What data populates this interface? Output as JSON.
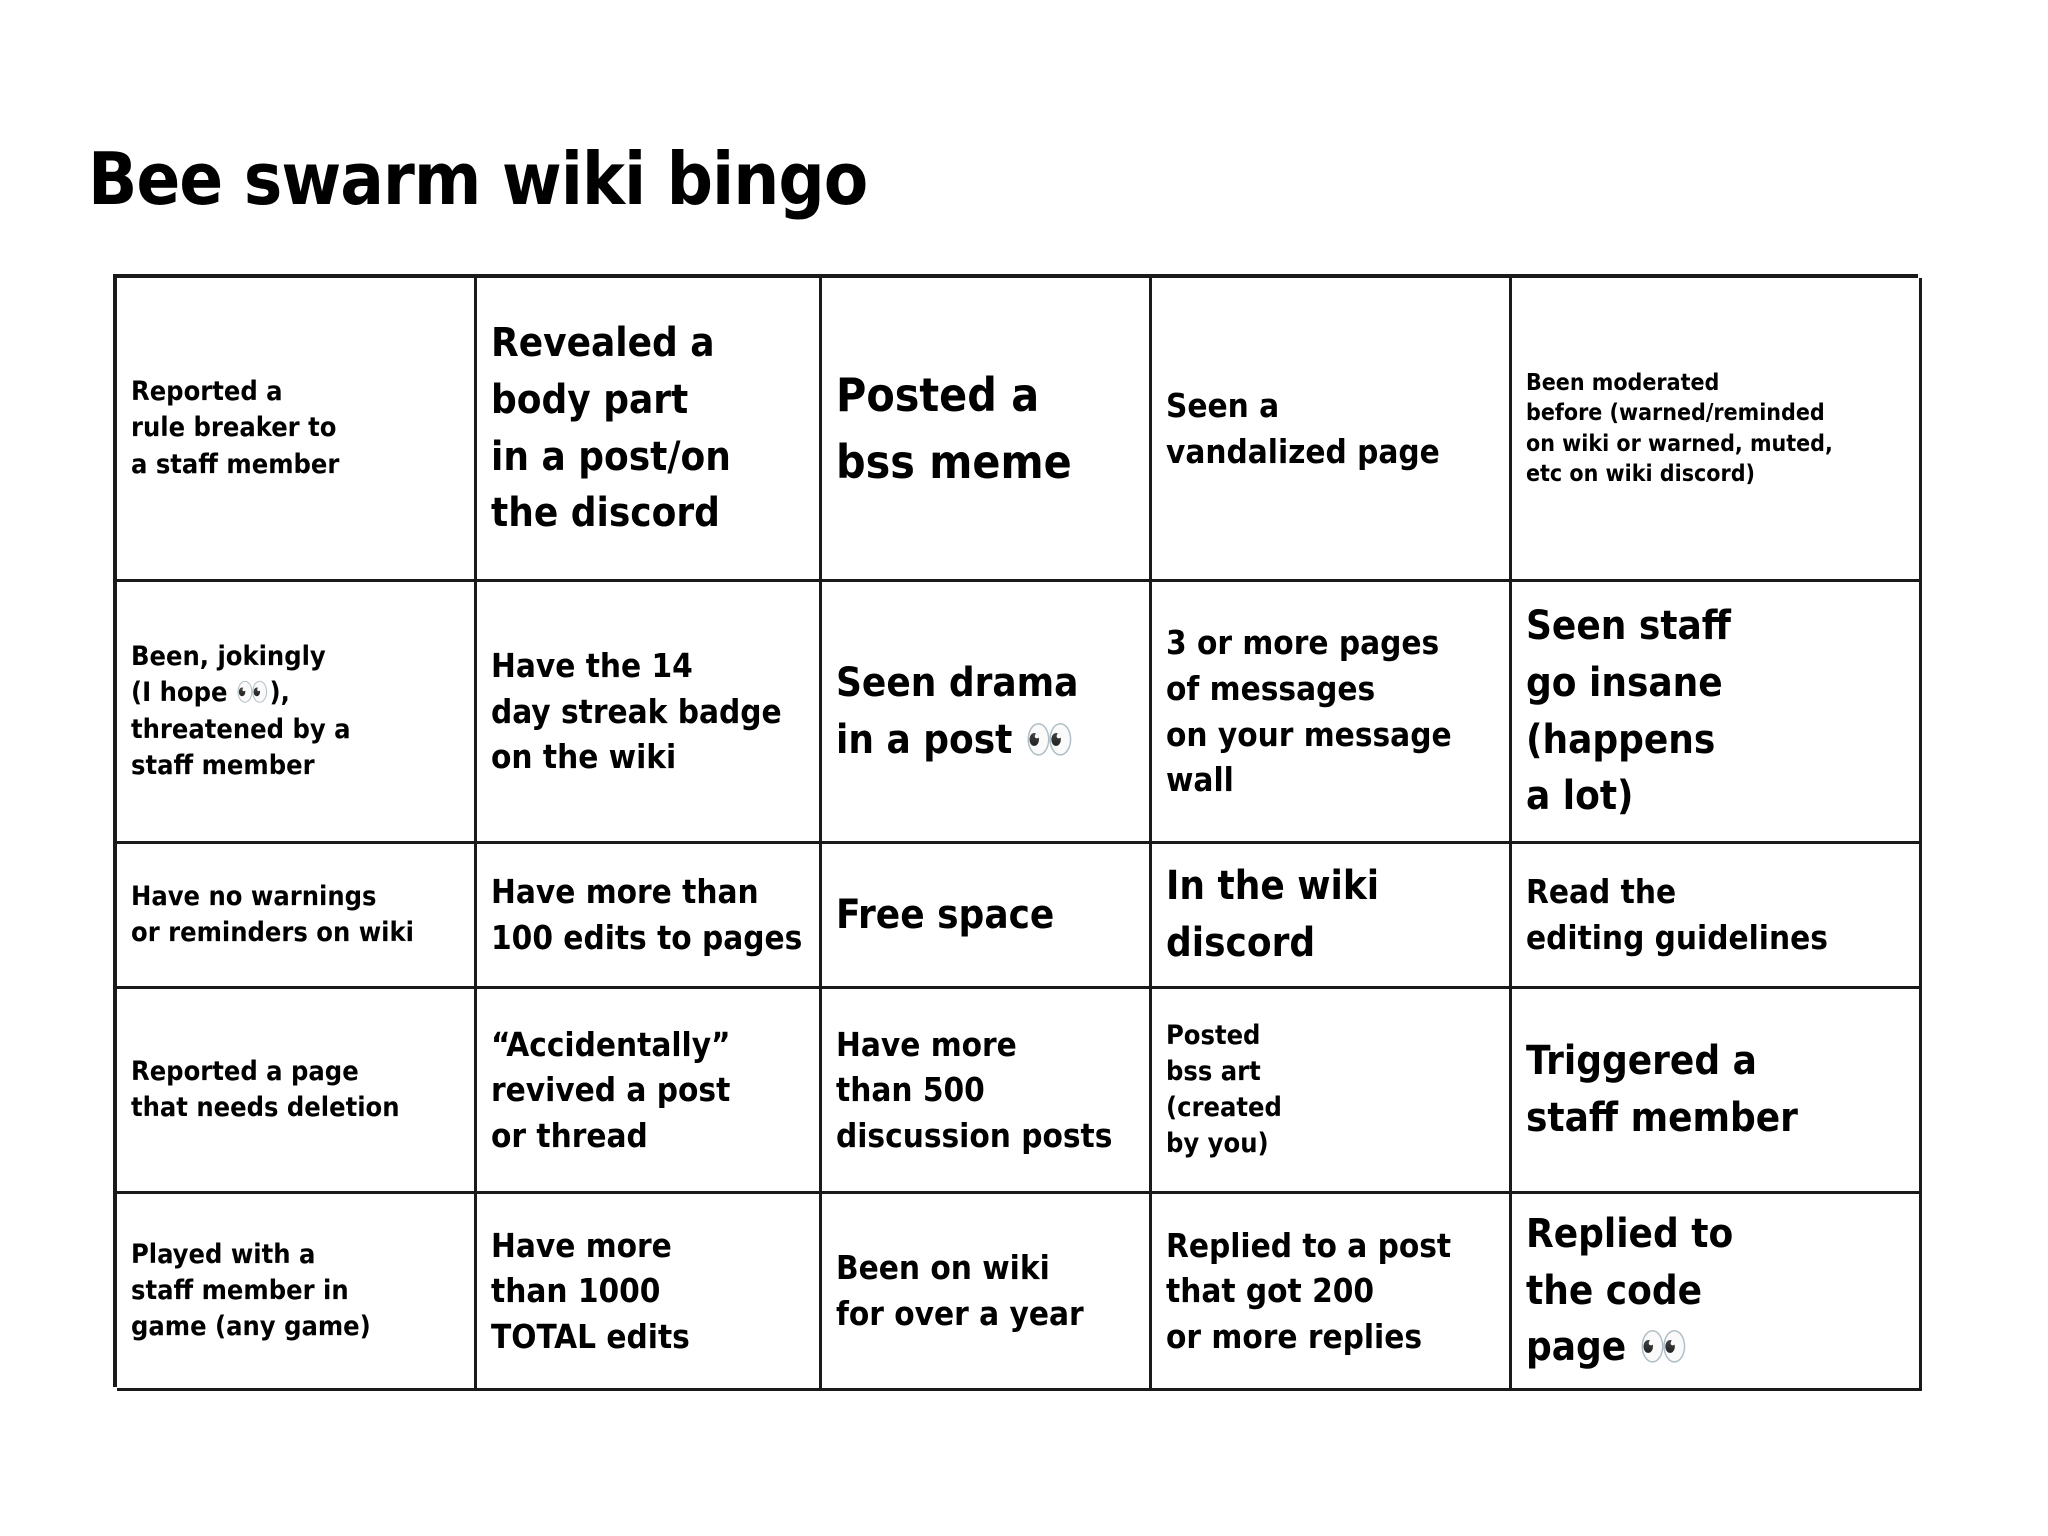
{
  "title": "Bee swarm wiki bingo",
  "grid": {
    "columns": 5,
    "rows": 5,
    "cells": [
      {
        "text": "Reported a\nrule breaker to\na staff member",
        "size": "sm"
      },
      {
        "text": "Revealed a\nbody part\nin a post/on\nthe discord",
        "size": "lg"
      },
      {
        "text": "Posted a\nbss meme",
        "size": "xl"
      },
      {
        "text": "Seen a\nvandalized page",
        "size": "md"
      },
      {
        "text": "Been moderated\nbefore (warned/reminded\non wiki or warned, muted,\netc on wiki discord)",
        "size": "xs"
      },
      {
        "text": "Been, jokingly\n(I hope 👀),\nthreatened by a\nstaff member",
        "size": "sm"
      },
      {
        "text": "Have the 14\nday streak badge\non the wiki",
        "size": "md"
      },
      {
        "text": "Seen drama\nin a post 👀",
        "size": "lg"
      },
      {
        "text": "3 or more pages\nof messages\non your message\nwall",
        "size": "md"
      },
      {
        "text": "Seen staff\ngo insane\n(happens\na lot)",
        "size": "lg"
      },
      {
        "text": "Have no warnings\nor reminders on wiki",
        "size": "sm"
      },
      {
        "text": "Have more than\n100 edits to pages",
        "size": "md"
      },
      {
        "text": "Free space",
        "size": "lg"
      },
      {
        "text": "In the wiki\ndiscord",
        "size": "lg"
      },
      {
        "text": "Read the\nediting guidelines",
        "size": "md"
      },
      {
        "text": "Reported a page\nthat needs deletion",
        "size": "sm"
      },
      {
        "text": "“Accidentally”\nrevived a post\nor thread",
        "size": "md"
      },
      {
        "text": "Have more\nthan 500\ndiscussion posts",
        "size": "md"
      },
      {
        "text": "Posted\nbss art\n(created\nby you)",
        "size": "sm"
      },
      {
        "text": "Triggered a\nstaff member",
        "size": "lg"
      },
      {
        "text": "Played with a\nstaff member in\ngame (any game)",
        "size": "sm"
      },
      {
        "text": "Have more\nthan 1000\nTOTAL edits",
        "size": "md"
      },
      {
        "text": "Been on wiki\nfor over a year",
        "size": "md"
      },
      {
        "text": "Replied to a post\nthat got 200\nor more replies",
        "size": "md"
      },
      {
        "text": "Replied to\nthe code\npage 👀",
        "size": "lg"
      }
    ]
  },
  "colors": {
    "background": "#ffffff",
    "text": "#000000",
    "grid_line": "#1a1a1a"
  }
}
